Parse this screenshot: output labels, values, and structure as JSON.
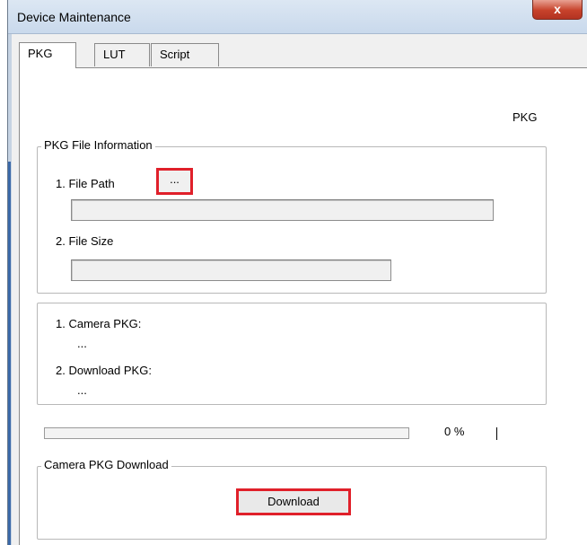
{
  "window": {
    "title": "Device Maintenance",
    "close_glyph": "x"
  },
  "tabs": [
    {
      "label": "PKG",
      "active": true
    },
    {
      "label": "LUT",
      "active": false
    },
    {
      "label": "Script",
      "active": false
    }
  ],
  "panel": {
    "pkg_label": "PKG",
    "file_info": {
      "legend": "PKG File Information",
      "file_path_label": "1. File Path",
      "browse_label": "...",
      "file_path_value": "",
      "file_size_label": "2. File Size",
      "file_size_value": ""
    },
    "versions": {
      "camera_pkg_label": "1. Camera PKG:",
      "camera_pkg_value": "...",
      "download_pkg_label": "2. Download PKG:",
      "download_pkg_value": "..."
    },
    "progress": {
      "percent_text": "0 %",
      "value": 0,
      "fill_color": "#38b000"
    },
    "download_group": {
      "legend": "Camera PKG Download",
      "button_label": "Download"
    }
  },
  "colors": {
    "highlight_border": "#e0202a",
    "close_button": "#c7422b"
  }
}
